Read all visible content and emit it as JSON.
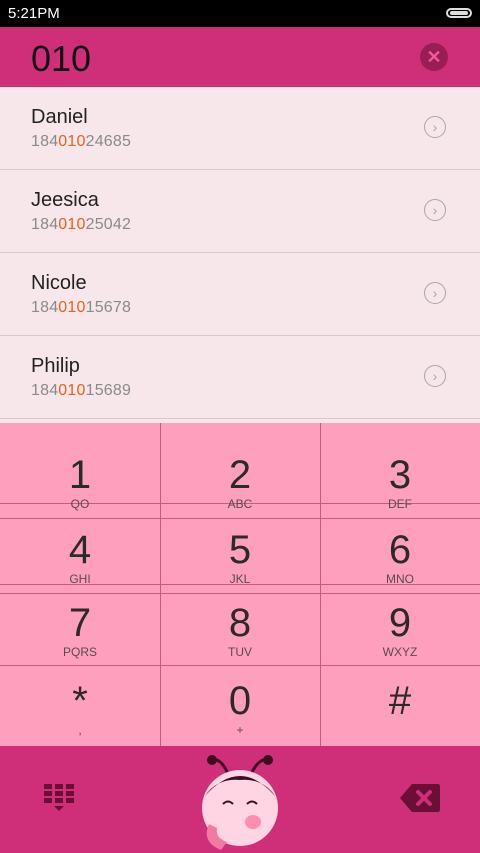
{
  "status_bar": {
    "time": "5:21PM"
  },
  "dialer": {
    "input": "010",
    "clear_icon": "close-icon"
  },
  "contacts": [
    {
      "name": "Daniel",
      "number_prefix": "184",
      "number_match": "010",
      "number_suffix": "24685"
    },
    {
      "name": "Jeesica",
      "number_prefix": "184",
      "number_match": "010",
      "number_suffix": "25042"
    },
    {
      "name": "Nicole",
      "number_prefix": "184",
      "number_match": "010",
      "number_suffix": "15678"
    },
    {
      "name": "Philip",
      "number_prefix": "184",
      "number_match": "010",
      "number_suffix": "15689"
    }
  ],
  "keypad": {
    "keys": [
      {
        "digit": "1",
        "letters": "QO"
      },
      {
        "digit": "2",
        "letters": "ABC"
      },
      {
        "digit": "3",
        "letters": "DEF"
      },
      {
        "digit": "4",
        "letters": "GHI"
      },
      {
        "digit": "5",
        "letters": "JKL"
      },
      {
        "digit": "6",
        "letters": "MNO"
      },
      {
        "digit": "7",
        "letters": "PQRS"
      },
      {
        "digit": "8",
        "letters": "TUV"
      },
      {
        "digit": "9",
        "letters": "WXYZ"
      },
      {
        "digit": "*",
        "letters": ","
      },
      {
        "digit": "0",
        "letters": "+"
      },
      {
        "digit": "#",
        "letters": ""
      }
    ]
  },
  "bottom_bar": {
    "left_icon": "dialpad-grid-icon",
    "center_icon": "ladybug-call-mascot-icon",
    "right_icon": "backspace-icon"
  },
  "colors": {
    "accent": "#cf2e79",
    "keypad_bg": "#ff9fbe",
    "list_bg": "#f7e6ea",
    "match_highlight": "#e8641c"
  }
}
